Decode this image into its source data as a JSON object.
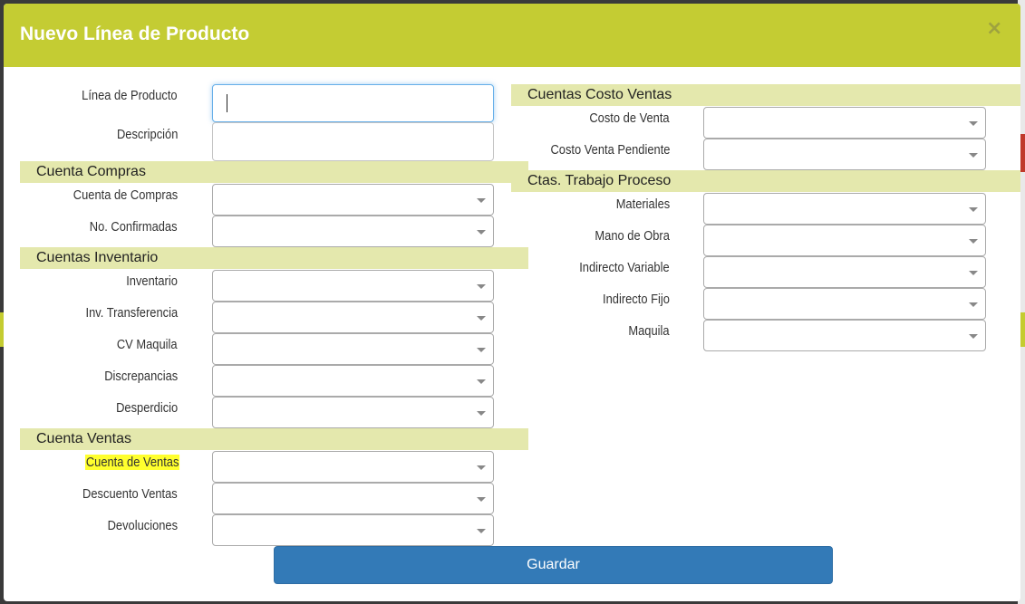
{
  "modal": {
    "title": "Nuevo Línea de Producto",
    "close_label": "×",
    "save_label": "Guardar"
  },
  "fields": {
    "linea_producto": {
      "label": "Línea de Producto",
      "value": ""
    },
    "descripcion": {
      "label": "Descripción",
      "value": ""
    }
  },
  "sections": {
    "compras": {
      "title": "Cuenta Compras",
      "fields": [
        {
          "label": "Cuenta de Compras",
          "value": ""
        },
        {
          "label": "No. Confirmadas",
          "value": ""
        }
      ]
    },
    "inventario": {
      "title": "Cuentas Inventario",
      "fields": [
        {
          "label": "Inventario",
          "value": ""
        },
        {
          "label": "Inv. Transferencia",
          "value": ""
        },
        {
          "label": "CV Maquila",
          "value": ""
        },
        {
          "label": "Discrepancias",
          "value": ""
        },
        {
          "label": "Desperdicio",
          "value": ""
        }
      ]
    },
    "ventas": {
      "title": "Cuenta Ventas",
      "fields": [
        {
          "label": "Cuenta de Ventas",
          "value": "",
          "highlighted": true
        },
        {
          "label": "Descuento Ventas",
          "value": ""
        },
        {
          "label": "Devoluciones",
          "value": ""
        }
      ]
    },
    "costo_ventas": {
      "title": "Cuentas Costo Ventas",
      "fields": [
        {
          "label": "Costo de Venta",
          "value": ""
        },
        {
          "label": "Costo Venta Pendiente",
          "value": ""
        }
      ]
    },
    "trabajo_proceso": {
      "title": "Ctas. Trabajo Proceso",
      "fields": [
        {
          "label": "Materiales",
          "value": ""
        },
        {
          "label": "Mano de Obra",
          "value": ""
        },
        {
          "label": "Indirecto Variable",
          "value": ""
        },
        {
          "label": "Indirecto Fijo",
          "value": ""
        },
        {
          "label": "Maquila",
          "value": ""
        }
      ]
    }
  },
  "colors": {
    "header": "#c4cc33",
    "section_bar": "#e4e8ad",
    "primary_button": "#337ab7",
    "highlight": "#ffff2e"
  }
}
